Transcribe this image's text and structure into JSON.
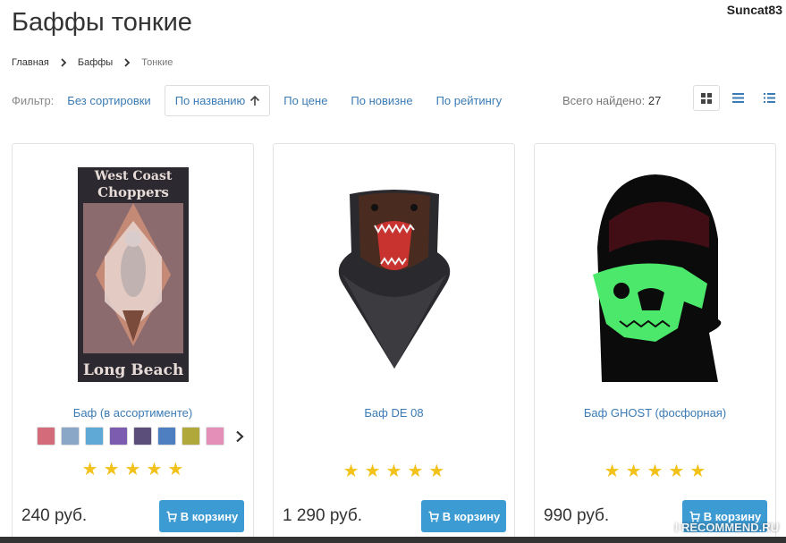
{
  "page": {
    "title": "Баффы тонкие",
    "username": "Suncat83"
  },
  "breadcrumb": [
    "Главная",
    "Баффы",
    "Тонкие"
  ],
  "filter": {
    "label": "Фильтр:",
    "options": [
      "Без сортировки",
      "По названию",
      "По цене",
      "По новизне",
      "По рейтингу"
    ],
    "active_index": 1,
    "total_label": "Всего найдено:",
    "total_count": "27"
  },
  "colors": {
    "link": "#3a7bb5",
    "star": "#f2c21b",
    "button": "#3d9bd3"
  },
  "products": [
    {
      "name": "Баф (в ассортименте)",
      "price": "240 руб.",
      "cart_label": "В корзину",
      "rating": 5
    },
    {
      "name": "Баф DE 08",
      "price": "1 290 руб.",
      "cart_label": "В корзину",
      "rating": 5
    },
    {
      "name": "Баф GHOST (фосфорная)",
      "price": "990 руб.",
      "cart_label": "В корзину",
      "rating": 5
    }
  ],
  "product1_image_text": {
    "top": "West Coast",
    "middle": "Choppers",
    "bottom": "Long Beach"
  },
  "swatch_colors": [
    "#d36b7a",
    "#8aa7c8",
    "#5fa9d6",
    "#7b5cae",
    "#5b4e7a",
    "#4d7fc1",
    "#b0a83a",
    "#e38fb7"
  ],
  "watermark": "I RECOMMEND.RU"
}
